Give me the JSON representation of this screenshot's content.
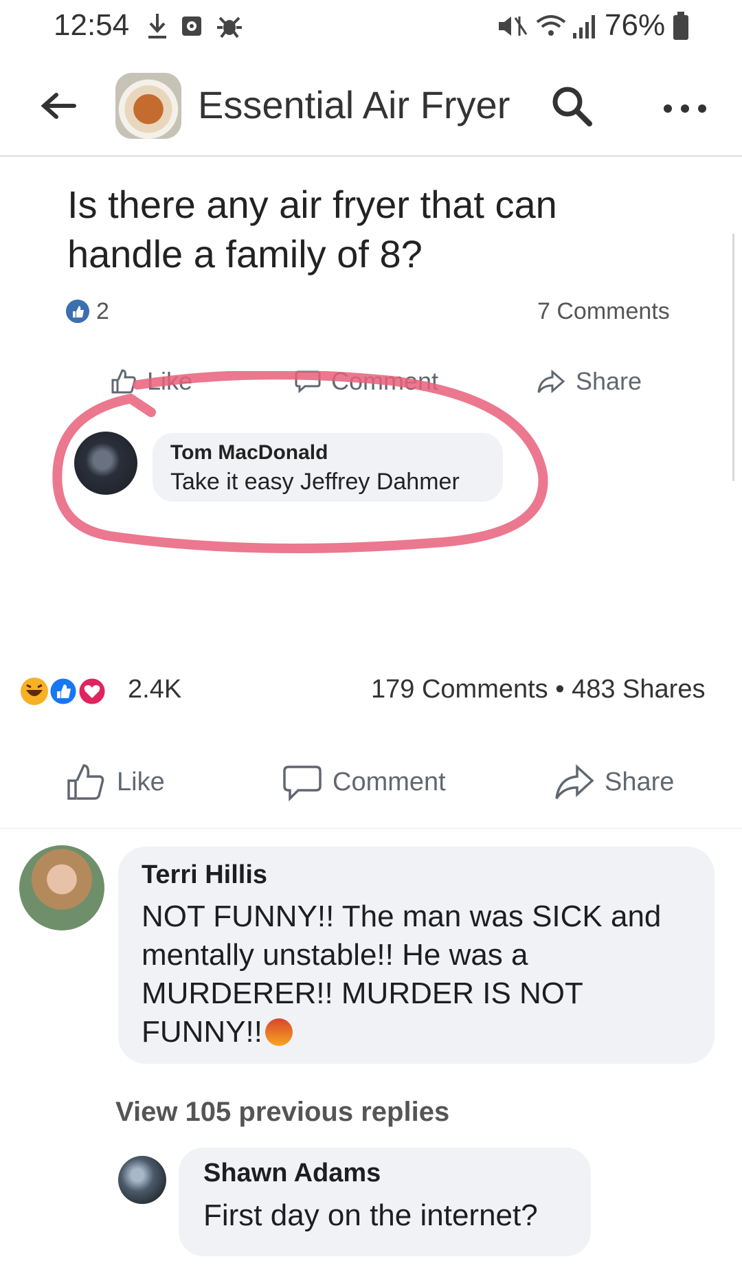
{
  "status_bar": {
    "time": "12:54",
    "battery": "76%",
    "icons": [
      "download-icon",
      "camera-icon",
      "bug-icon",
      "mute-icon",
      "wifi-icon",
      "signal-icon",
      "battery-icon"
    ]
  },
  "header": {
    "group_name": "Essential Air Fryer",
    "icons": [
      "back-arrow-icon",
      "search-icon",
      "more-icon"
    ]
  },
  "inner_post": {
    "question": "Is there any air fryer that can handle a family of 8?",
    "like_count": "2",
    "comments_count": "7 Comments",
    "actions": {
      "like": "Like",
      "comment": "Comment",
      "share": "Share"
    },
    "comment": {
      "author": "Tom MacDonald",
      "text": "Take it easy Jeffrey Dahmer"
    },
    "highlight_color": "#e8607a"
  },
  "outer_post": {
    "reaction_count": "2.4K",
    "stats": "179 Comments • 483 Shares",
    "actions": {
      "like": "Like",
      "comment": "Comment",
      "share": "Share"
    }
  },
  "comments": [
    {
      "author": "Terri Hillis",
      "text": "NOT FUNNY!! The man was SICK and mentally unstable!! He was a MURDERER!! MURDER IS NOT FUNNY!!",
      "emoji": "angry-face-icon"
    }
  ],
  "view_replies": "View 105 previous replies",
  "reply": {
    "author": "Shawn Adams",
    "text": "First day on the internet?"
  },
  "colors": {
    "facebook_blue": "#3b6fb0",
    "like_blue": "#1877f2",
    "love_red": "#e0245e",
    "haha_yellow": "#f7b125",
    "bubble_bg": "#f0f2f5"
  }
}
